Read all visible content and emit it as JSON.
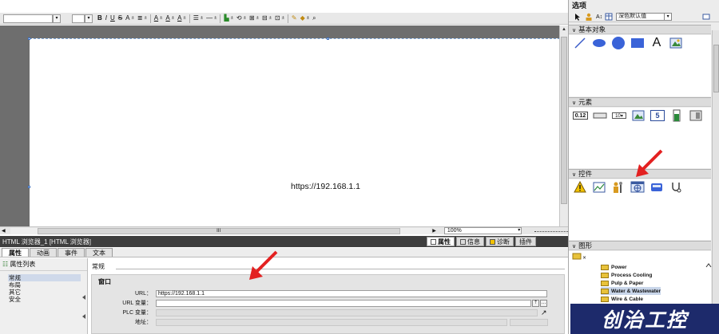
{
  "toolbar": {
    "format_buttons": [
      "B",
      "I",
      "U",
      "S",
      "A",
      "A",
      "A",
      "A"
    ]
  },
  "canvas": {
    "url_text": "https://192.168.1.1"
  },
  "editor": {
    "hscroll_label": "III",
    "zoom": "100%"
  },
  "properties": {
    "title": "HTML 浏览器_1 [HTML 浏览器]",
    "tabs_right": [
      {
        "label": "属性"
      },
      {
        "label": "信息"
      },
      {
        "label": "诊断"
      },
      {
        "label": "插件"
      }
    ],
    "sub_tabs": [
      "属性",
      "动画",
      "事件",
      "文本"
    ],
    "list_title": "属性列表",
    "categories": [
      "常规",
      "布局",
      "其它",
      "安全"
    ],
    "section": "常规",
    "group": "窗口",
    "fields": [
      {
        "label": "URL：",
        "value": "https://192.168.1.1"
      },
      {
        "label": "URL 变量：",
        "value": ""
      },
      {
        "label": "PLC 变量：",
        "value": ""
      },
      {
        "label": "地址：",
        "value": ""
      }
    ]
  },
  "toolbox": {
    "title": "选项",
    "style_select": "深色默认值",
    "sections": {
      "basic": "基本对象",
      "elements": "元素",
      "controls": "控件",
      "graphics": "图形"
    },
    "elements_io_label": "0.12",
    "elements_date_label": "5",
    "library_items": [
      "Power",
      "Process Cooling",
      "Pulp & Paper",
      "Water & Wastewater",
      "Wire & Cable"
    ]
  },
  "colors": {
    "arrow": "#e32121",
    "watermark_bg": "#1d2a6b"
  },
  "watermark": "创治工控"
}
